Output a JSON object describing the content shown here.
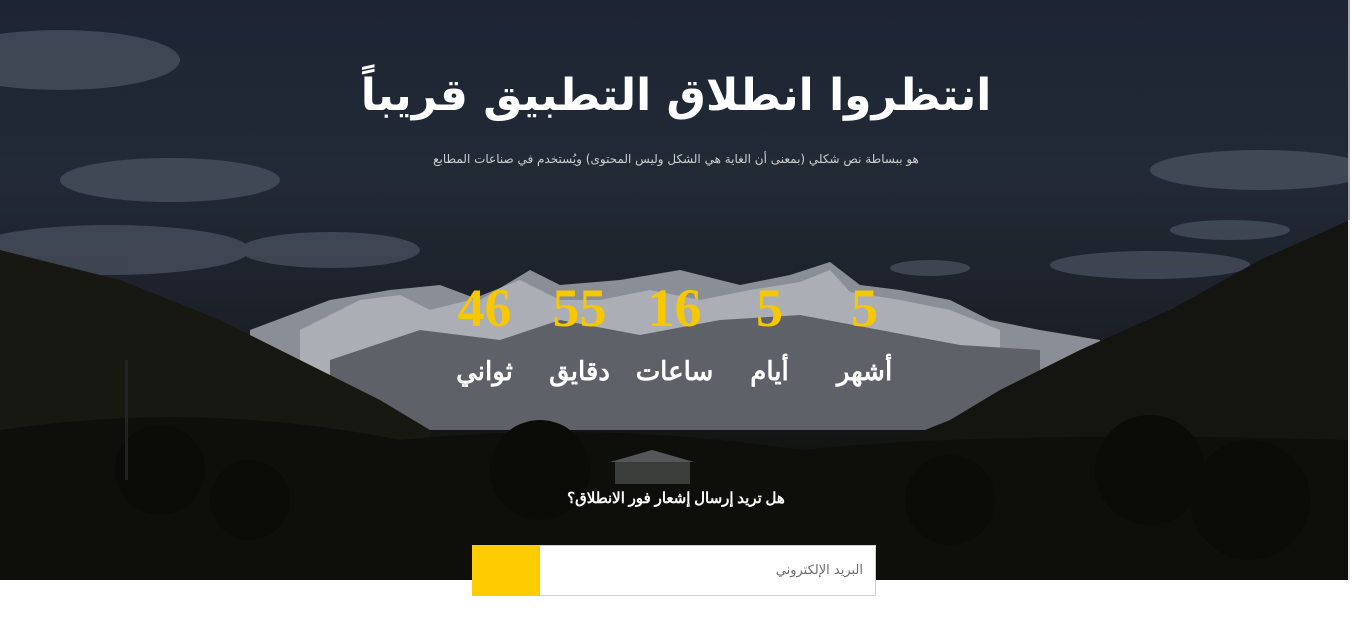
{
  "hero": {
    "title": "انتظروا انطلاق التطبيق قريباً",
    "subtitle": "هو ببساطة نص شكلي (بمعنى أن الغاية هي الشكل وليس المحتوى) ويُستخدم في صناعات المطابع"
  },
  "countdown": [
    {
      "value": "5",
      "label": "أشهر"
    },
    {
      "value": "5",
      "label": "أيام"
    },
    {
      "value": "16",
      "label": "ساعات"
    },
    {
      "value": "55",
      "label": "دقايق"
    },
    {
      "value": "46",
      "label": "ثواني"
    }
  ],
  "notify": {
    "question": "هل تريد إرسال إشعار فور الانطلاق؟",
    "email_placeholder": "البريد الإلكتروني",
    "submit_label": ""
  },
  "colors": {
    "accent": "#ffcc00",
    "countdown_number": "#f7c700"
  }
}
